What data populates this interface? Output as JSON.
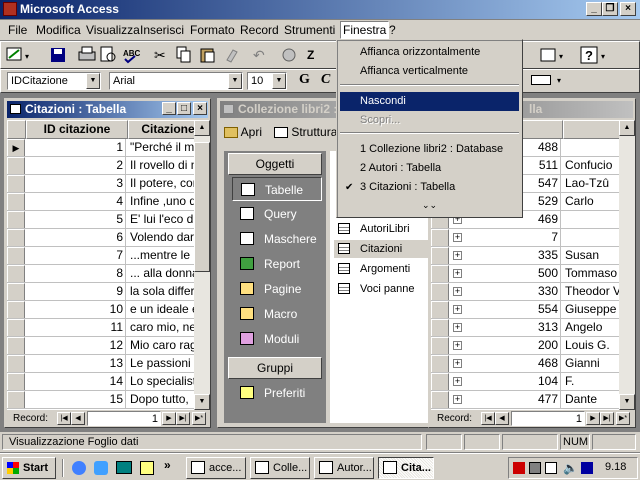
{
  "app": {
    "title": "Microsoft Access"
  },
  "menubar": [
    {
      "label": "File",
      "ul": "F",
      "rest": "ile"
    },
    {
      "label": "Modifica",
      "ul": "M",
      "rest": "odifica"
    },
    {
      "label": "Visualizza",
      "ul": "V",
      "rest": "isualizza"
    },
    {
      "label": "Inserisci",
      "ul": "I",
      "rest": "nserisci"
    },
    {
      "label": "Formato",
      "ul": "o",
      "rest": "Formato"
    },
    {
      "label": "Record",
      "ul": "R",
      "rest": "ecord"
    },
    {
      "label": "Strumenti",
      "ul": "S",
      "rest": "trumenti"
    },
    {
      "label": "Finestra",
      "ul": "n",
      "rest": "Finestra"
    },
    {
      "label": "?",
      "ul": "?",
      "rest": ""
    }
  ],
  "format_toolbar": {
    "object_combo": "IDCitazione",
    "font_combo": "Arial",
    "size_combo": "10",
    "bold": "G",
    "italic": "C"
  },
  "finestra_menu": {
    "items": [
      {
        "label": "Affianca orizzontalmente",
        "state": "normal"
      },
      {
        "label": "Affianca verticalmente",
        "state": "normal"
      },
      {
        "label": "Nascondi",
        "state": "highlight"
      },
      {
        "label": "Scopri...",
        "state": "disabled"
      },
      {
        "label": "1 Collezione libri2 : Database",
        "state": "normal"
      },
      {
        "label": "2 Autori : Tabella",
        "state": "normal"
      },
      {
        "label": "3 Citazioni : Tabella",
        "state": "checked"
      }
    ],
    "more": "⌄⌄"
  },
  "citazioni_window": {
    "title": "Citazioni : Tabella",
    "col_id": "ID citazione",
    "col_text": "Citazione",
    "rows": [
      {
        "id": "1",
        "text": "\"Perché il m"
      },
      {
        "id": "2",
        "text": "Il rovello di n"
      },
      {
        "id": "3",
        "text": "Il potere, con"
      },
      {
        "id": "4",
        "text": "Infine ,uno d"
      },
      {
        "id": "5",
        "text": "E' lui l'eco di"
      },
      {
        "id": "6",
        "text": "Volendo darn"
      },
      {
        "id": "7",
        "text": "...mentre le"
      },
      {
        "id": "8",
        "text": "... alla donna"
      },
      {
        "id": "9",
        "text": "la sola differe"
      },
      {
        "id": "10",
        "text": "e un ideale è"
      },
      {
        "id": "11",
        "text": "caro mio, ne"
      },
      {
        "id": "12",
        "text": "Mio caro rag"
      },
      {
        "id": "13",
        "text": "Le passioni"
      },
      {
        "id": "14",
        "text": "Lo specialist"
      },
      {
        "id": "15",
        "text": "Dopo tutto,"
      }
    ],
    "record_label": "Record:",
    "record_value": "1"
  },
  "db_window": {
    "title": "Collezione libri2 :",
    "open_label": "Apri",
    "structure_label": "Struttura",
    "objects_header": "Oggetti",
    "objects": [
      "Tabelle",
      "Query",
      "Maschere",
      "Report",
      "Pagine",
      "Macro",
      "Moduli"
    ],
    "groups_header": "Gruppi",
    "favorites": "Preferiti",
    "list": [
      "Crea una t",
      "Libri",
      "Autori",
      "AutoriLibri",
      "Citazioni",
      "Argomenti",
      "Voci panne"
    ]
  },
  "autori_window": {
    "title": "lla",
    "col_header": "ore",
    "rows": [
      {
        "num": "488",
        "name": ""
      },
      {
        "num": "511",
        "name": "Confucio"
      },
      {
        "num": "547",
        "name": "Lao-Tzû"
      },
      {
        "num": "529",
        "name": "Carlo"
      },
      {
        "num": "469",
        "name": ""
      },
      {
        "num": "7",
        "name": ""
      },
      {
        "num": "335",
        "name": "Susan"
      },
      {
        "num": "500",
        "name": "Tommaso"
      },
      {
        "num": "330",
        "name": "Theodor V"
      },
      {
        "num": "554",
        "name": "Giuseppe"
      },
      {
        "num": "313",
        "name": "Angelo"
      },
      {
        "num": "200",
        "name": "Louis G."
      },
      {
        "num": "468",
        "name": "Gianni"
      },
      {
        "num": "104",
        "name": "F."
      },
      {
        "num": "477",
        "name": "Dante"
      }
    ],
    "record_label": "Record:",
    "record_value": "1"
  },
  "statusbar": {
    "text": "Visualizzazione Foglio dati",
    "num": "NUM"
  },
  "taskbar": {
    "start": "Start",
    "tasks": [
      "acce...",
      "Colle...",
      "Autor...",
      "Cita..."
    ],
    "clock": "9.18"
  }
}
